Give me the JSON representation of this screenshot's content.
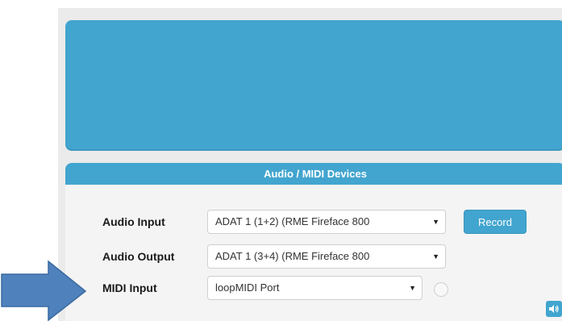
{
  "devices": {
    "title": "Audio / MIDI Devices",
    "audio_input": {
      "label": "Audio Input",
      "value": "ADAT 1 (1+2) (RME Fireface 800"
    },
    "audio_output": {
      "label": "Audio Output",
      "value": "ADAT 1 (3+4) (RME Fireface 800"
    },
    "midi_input": {
      "label": "MIDI Input",
      "value": "loopMIDI Port"
    },
    "record_label": "Record",
    "caret": "▼"
  },
  "colors": {
    "accent": "#42a5cf",
    "arrow": "#4f81bd",
    "frame": "#ebebeb"
  },
  "icons": {
    "arrow": "right-arrow-icon",
    "speaker": "speaker-icon"
  }
}
